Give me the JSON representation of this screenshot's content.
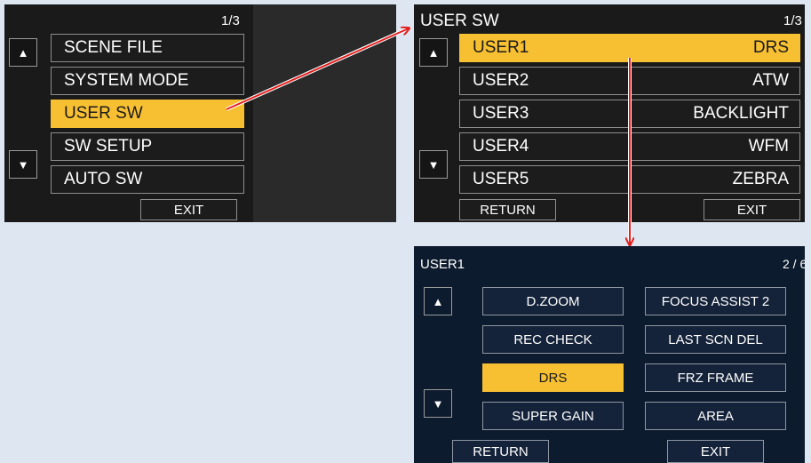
{
  "menu": {
    "page": "1/3",
    "items": [
      {
        "label": "SCENE FILE",
        "selected": false
      },
      {
        "label": "SYSTEM MODE",
        "selected": false
      },
      {
        "label": "USER SW",
        "selected": true
      },
      {
        "label": "SW SETUP",
        "selected": false
      },
      {
        "label": "AUTO SW",
        "selected": false
      }
    ],
    "exit": "EXIT",
    "up": "▲",
    "down": "▼"
  },
  "user_sw": {
    "title": "USER SW",
    "page": "1/3",
    "rows": [
      {
        "label": "USER1",
        "value": "DRS",
        "selected": true
      },
      {
        "label": "USER2",
        "value": "ATW",
        "selected": false
      },
      {
        "label": "USER3",
        "value": "BACKLIGHT",
        "selected": false
      },
      {
        "label": "USER4",
        "value": "WFM",
        "selected": false
      },
      {
        "label": "USER5",
        "value": "ZEBRA",
        "selected": false
      }
    ],
    "return": "RETURN",
    "exit": "EXIT",
    "up": "▲",
    "down": "▼"
  },
  "user1": {
    "title": "USER1",
    "page": "2 / 6",
    "left": [
      {
        "label": "D.ZOOM",
        "selected": false
      },
      {
        "label": "REC CHECK",
        "selected": false
      },
      {
        "label": "DRS",
        "selected": true
      },
      {
        "label": "SUPER GAIN",
        "selected": false
      }
    ],
    "right": [
      {
        "label": "FOCUS ASSIST 2",
        "selected": false
      },
      {
        "label": "LAST SCN DEL",
        "selected": false
      },
      {
        "label": "FRZ FRAME",
        "selected": false
      },
      {
        "label": "AREA",
        "selected": false
      }
    ],
    "return": "RETURN",
    "exit": "EXIT",
    "up": "▲",
    "down": "▼"
  },
  "colors": {
    "highlight": "#f7c032",
    "arrow": "#e02020"
  }
}
